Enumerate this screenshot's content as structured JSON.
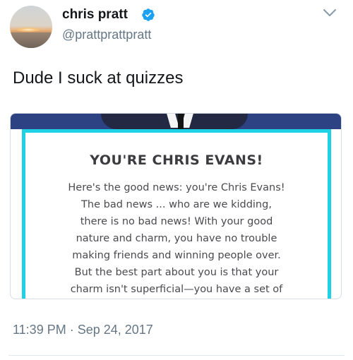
{
  "tweet": {
    "author": {
      "display_name": "chris pratt",
      "handle": "@prattprattpratt",
      "verified": true,
      "avatar_icon": "sunset-landscape-avatar"
    },
    "text": "Dude I suck at quizzes",
    "timestamp": "11:39 PM · Sep 24, 2017"
  },
  "media": {
    "quiz_result": {
      "title": "YOU'RE CHRIS EVANS!",
      "body": "Here's the good news: you're Chris Evans!\nThe bad news ... who are we kidding,\nthere is no bad news! With your good\nnature and charm, you have no trouble\nmaking friends and winning people over.\nBut the best part about you is that your\ncharm isn't superficial—you have a set of"
    }
  },
  "colors": {
    "verified_blue": "#1da1f2",
    "quiz_border": "#1fd1e4",
    "banner_navy": "#2c4282",
    "secondary_text": "#657786"
  },
  "icons": {
    "verified": "verified-badge-icon",
    "menu": "chevron-down-icon"
  }
}
